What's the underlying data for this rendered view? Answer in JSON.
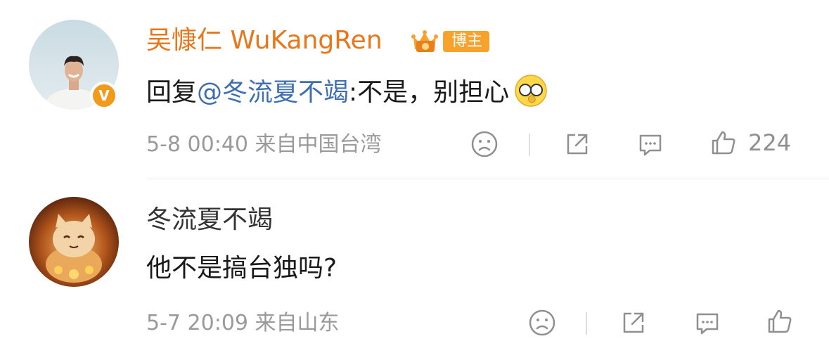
{
  "comments": [
    {
      "username": "吴慷仁 WuKangRen",
      "badge_label": "博主",
      "verified": true,
      "reply_prefix": "回复",
      "mention": "@冬流夏不竭",
      "content_text": ":不是，别担心",
      "emoji": "glasses-face-emoji",
      "date": "5-8 00:40",
      "source": "来自中国台湾",
      "like_count": "224",
      "colors": {
        "username": "#e8761a",
        "mention": "#3f6fb0",
        "badge": "#f7a22d"
      }
    },
    {
      "username": "冬流夏不竭",
      "content_text": "他不是搞台独吗?",
      "date": "5-7 20:09",
      "source": "来自山东",
      "colors": {
        "username": "#333333"
      }
    }
  ],
  "icons": {
    "dislike": "sad-face-icon",
    "share": "share-icon",
    "reply": "comment-icon",
    "like": "thumbs-up-icon"
  }
}
